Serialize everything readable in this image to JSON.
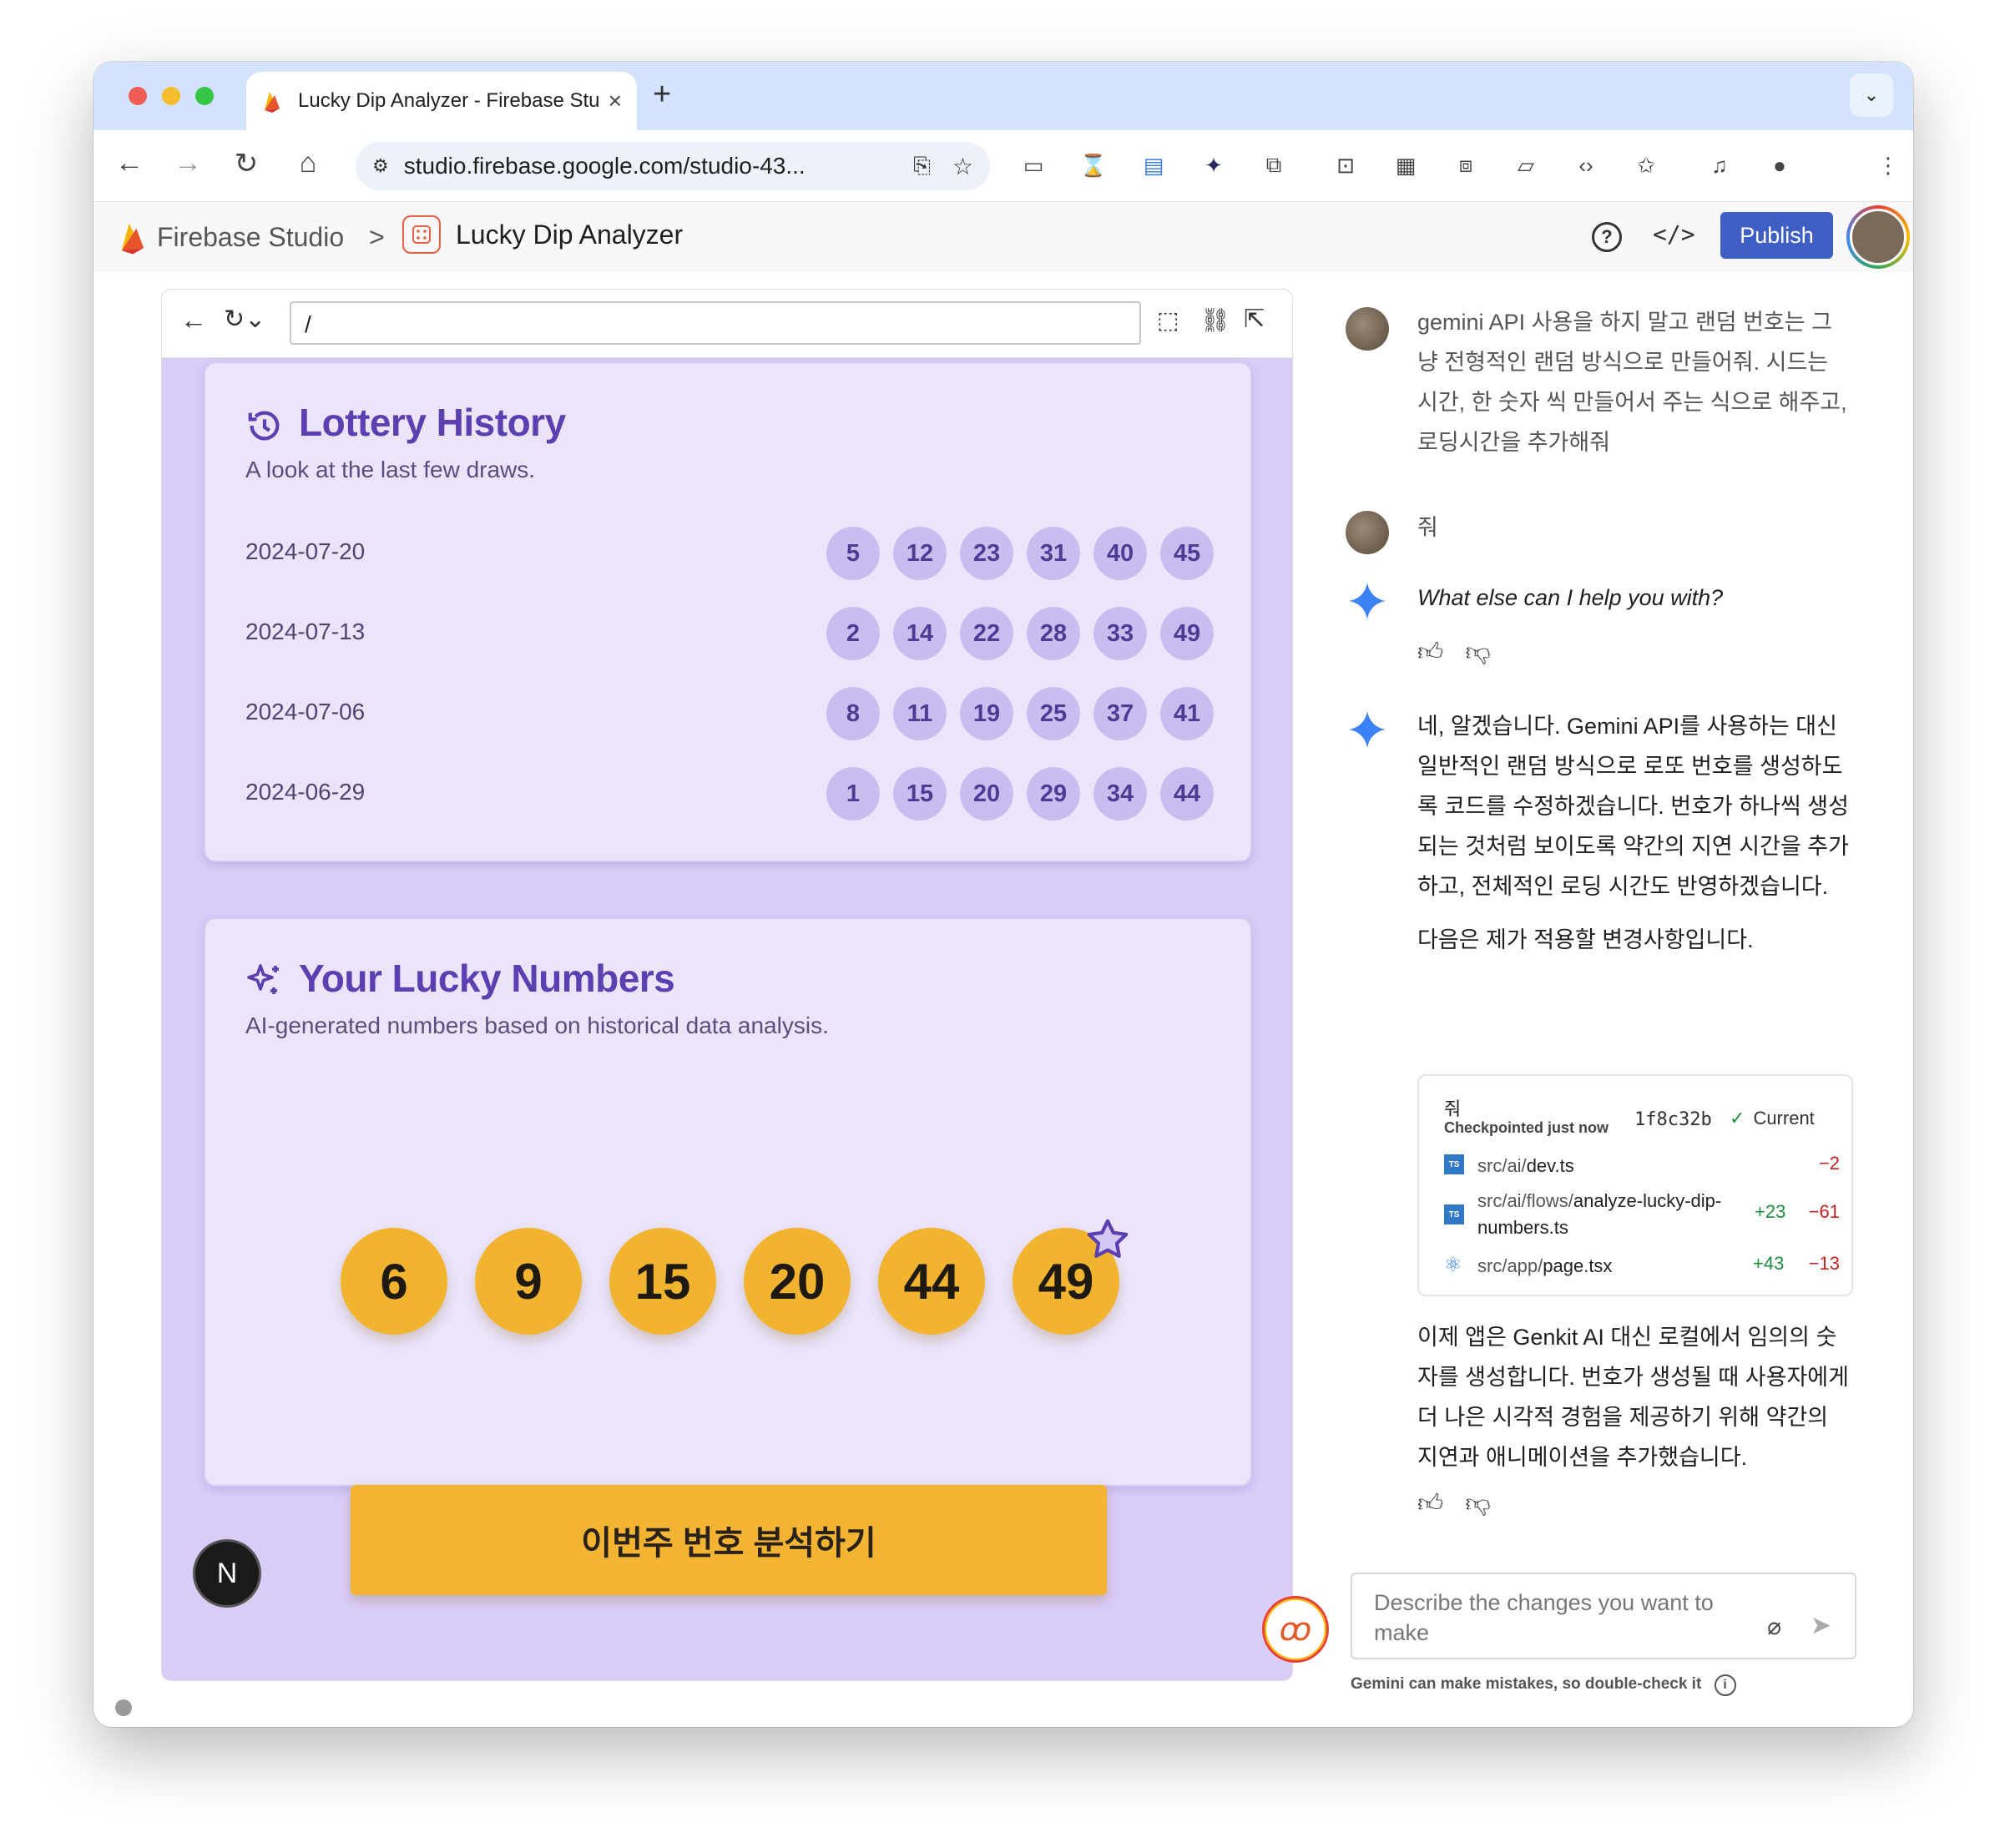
{
  "browser": {
    "tab_title": "Lucky Dip Analyzer - Firebase Studio",
    "tab_close": "×",
    "new_tab": "+",
    "url": "studio.firebase.google.com/studio-43..."
  },
  "app": {
    "brand": "Firebase Studio",
    "separator": ">",
    "project": "Lucky Dip Analyzer",
    "publish_label": "Publish",
    "help_label": "?",
    "code_label": "</>"
  },
  "preview": {
    "path": "/",
    "history": {
      "title": "Lottery History",
      "subtitle": "A look at the last few draws.",
      "draws": [
        {
          "date": "2024-07-20",
          "numbers": [
            "5",
            "12",
            "23",
            "31",
            "40",
            "45"
          ]
        },
        {
          "date": "2024-07-13",
          "numbers": [
            "2",
            "14",
            "22",
            "28",
            "33",
            "49"
          ]
        },
        {
          "date": "2024-07-06",
          "numbers": [
            "8",
            "11",
            "19",
            "25",
            "37",
            "41"
          ]
        },
        {
          "date": "2024-06-29",
          "numbers": [
            "1",
            "15",
            "20",
            "29",
            "34",
            "44"
          ]
        }
      ]
    },
    "lucky": {
      "title": "Your Lucky Numbers",
      "subtitle": "AI-generated numbers based on historical data analysis.",
      "numbers": [
        "6",
        "9",
        "15",
        "20",
        "44",
        "49"
      ]
    },
    "cta_label": "이번주 번호 분석하기",
    "badge": "N"
  },
  "chat": {
    "messages": [
      {
        "role": "user",
        "text": "gemini API 사용을 하지 말고 랜덤 번호는 그냥 전형적인 랜덤 방식으로 만들어줘. 시드는 시간, 한 숫자 씩 만들어서 주는 식으로 해주고, 로딩시간을 추가해줘"
      },
      {
        "role": "user",
        "text": "줘"
      },
      {
        "role": "assistant",
        "text": "What else can I help you with?"
      },
      {
        "role": "assistant",
        "text": "네, 알겠습니다. Gemini API를 사용하는 대신 일반적인 랜덤 방식으로 로또 번호를 생성하도록 코드를 수정하겠습니다. 번호가 하나씩 생성되는 것처럼 보이도록 약간의 지연 시간을 추가하고, 전체적인 로딩 시간도 반영하겠습니다."
      },
      {
        "role": "assistant",
        "text": "다음은 제가 적용할 변경사항입니다."
      },
      {
        "role": "assistant",
        "text": "이제 앱은 Genkit AI 대신 로컬에서 임의의 숫자를 생성합니다. 번호가 생성될 때 사용자에게 더 나은 시각적 경험을 제공하기 위해 약간의 지연과 애니메이션을 추가했습니다."
      }
    ],
    "checkpoint": {
      "title": "줘",
      "when": "Checkpointed just now",
      "hash": "1f8c32b",
      "status": "Current",
      "files": [
        {
          "dir": "src/ai/",
          "name": "dev.ts",
          "added": "",
          "removed": "−2"
        },
        {
          "dir": "src/ai/flows/",
          "name": "analyze-lucky-dip-numbers.ts",
          "added": "+23",
          "removed": "−61"
        },
        {
          "dir": "src/app/",
          "name": "page.tsx",
          "added": "+43",
          "removed": "−13"
        }
      ]
    },
    "input_placeholder": "Describe the changes you want to make",
    "disclaimer": "Gemini can make mistakes, so double-check it"
  },
  "colors": {
    "accent": "#3f5fc5",
    "preview_bg": "#d9ccf7",
    "card_bg": "#ebe4fb",
    "title_purple": "#5c3fb0",
    "gold": "#f2b32f"
  }
}
